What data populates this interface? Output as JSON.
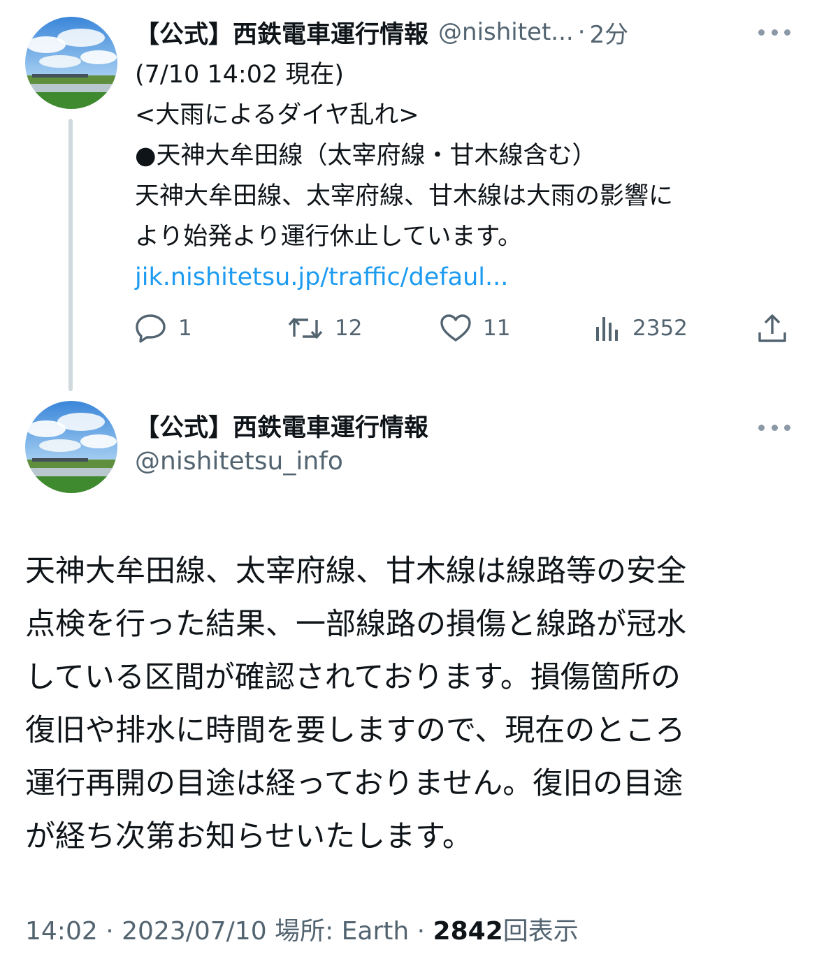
{
  "tweet1": {
    "display_name": "【公式】西鉄電車運行情報",
    "handle_truncated": "@nishitet...",
    "separator": "·",
    "time_ago": "2分",
    "lines": [
      "(7/10 14:02 現在)",
      "<大雨によるダイヤ乱れ>",
      "●天神大牟田線（太宰府線・甘木線含む）",
      "天神大牟田線、太宰府線、甘木線は大雨の影響に",
      "より始発より運行休止しています。"
    ],
    "link": "jik.nishitetsu.jp/traffic/defaul...",
    "actions": {
      "replies": "1",
      "retweets": "12",
      "likes": "11",
      "views": "2352"
    }
  },
  "tweet2": {
    "display_name": "【公式】西鉄電車運行情報",
    "handle": "@nishitetsu_info",
    "lines": [
      "天神大牟田線、太宰府線、甘木線は線路等の安全",
      "点検を行った結果、一部線路の損傷と線路が冠水",
      "している区間が確認されております。損傷箇所の",
      "復旧や排水に時間を要しますので、現在のところ",
      "運行再開の目途は経っておりません。復旧の目途",
      "が経ち次第お知らせいたします。"
    ],
    "meta": {
      "time": "14:02",
      "sep1": "·",
      "date": "2023/07/10",
      "location": "場所: Earth",
      "sep2": "·",
      "views": "2842",
      "views_label": "回表示"
    }
  },
  "colors": {
    "text": "#0f1419",
    "secondary": "#536471",
    "link": "#1d9bf0",
    "thread_line": "#cfd9de"
  },
  "icons": [
    "reply-icon",
    "retweet-icon",
    "like-icon",
    "views-icon",
    "share-icon",
    "more-icon"
  ]
}
